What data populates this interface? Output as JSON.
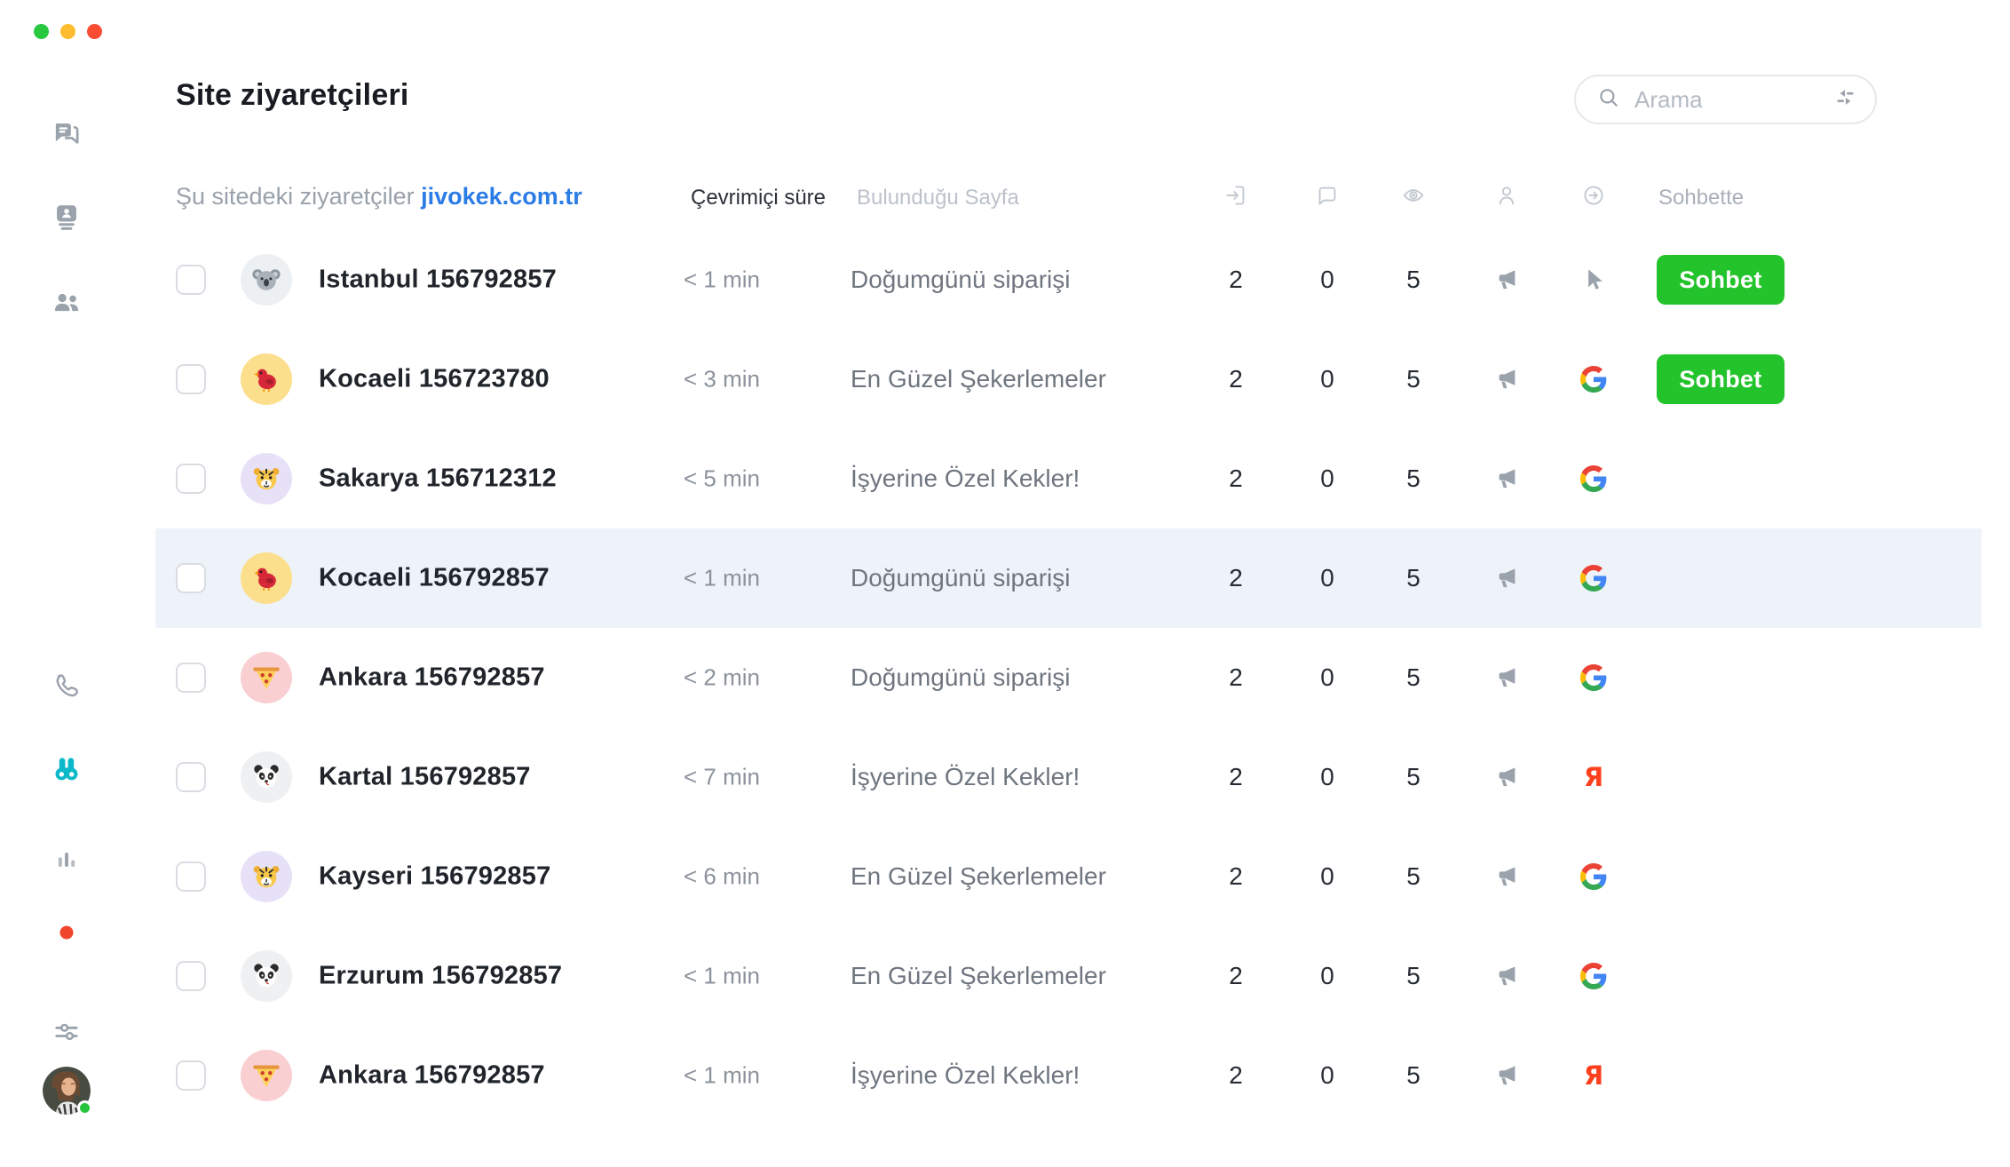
{
  "window": {
    "traffic_lights": [
      "green",
      "yellow",
      "red"
    ]
  },
  "sidebar": {
    "items": [
      {
        "icon": "chats-icon"
      },
      {
        "icon": "contact-card-icon"
      },
      {
        "icon": "people-icon"
      },
      {
        "icon": "phone-icon"
      },
      {
        "icon": "binoculars-icon",
        "active": true
      },
      {
        "icon": "bar-chart-icon"
      },
      {
        "icon": "notification-dot"
      },
      {
        "icon": "sliders-icon"
      },
      {
        "icon": "user-avatar",
        "status": "online"
      }
    ]
  },
  "page": {
    "title": "Site ziyaretçileri"
  },
  "search": {
    "placeholder": "Arama",
    "icons": [
      "search-icon",
      "filter-icon"
    ]
  },
  "table": {
    "subtitle": "Şu sitedeki ziyaretçiler",
    "site_link": "jivokek.com.tr",
    "columns": {
      "online_time": "Çevrimiçi süre",
      "current_page": "Bulunduğu Sayfa",
      "in_chat": "Sohbette",
      "icon_columns": [
        "login-icon",
        "chat-bubble-icon",
        "eye-icon",
        "visitor-icon",
        "redirect-icon"
      ]
    },
    "chat_button_label": "Sohbet",
    "rows": [
      {
        "name": "Istanbul 156792857",
        "online_time": "< 1 min",
        "page": "Doğumgünü siparişi",
        "visits": "2",
        "chats": "0",
        "views": "5",
        "avatar": "koala",
        "source": "cursor",
        "has_chat_button": true,
        "highlighted": false
      },
      {
        "name": "Kocaeli 156723780",
        "online_time": "< 3 min",
        "page": "En Güzel Şekerlemeler",
        "visits": "2",
        "chats": "0",
        "views": "5",
        "avatar": "bird",
        "source": "google",
        "has_chat_button": true,
        "highlighted": false
      },
      {
        "name": "Sakarya 156712312",
        "online_time": "< 5 min",
        "page": "İşyerine Özel Kekler!",
        "visits": "2",
        "chats": "0",
        "views": "5",
        "avatar": "tiger",
        "source": "google",
        "has_chat_button": false,
        "highlighted": false
      },
      {
        "name": "Kocaeli 156792857",
        "online_time": "< 1 min",
        "page": "Doğumgünü siparişi",
        "visits": "2",
        "chats": "0",
        "views": "5",
        "avatar": "bird",
        "source": "google",
        "has_chat_button": false,
        "highlighted": true
      },
      {
        "name": "Ankara 156792857",
        "online_time": "< 2 min",
        "page": "Doğumgünü siparişi",
        "visits": "2",
        "chats": "0",
        "views": "5",
        "avatar": "pizza",
        "source": "google",
        "has_chat_button": false,
        "highlighted": false
      },
      {
        "name": "Kartal 156792857",
        "online_time": "< 7 min",
        "page": "İşyerine Özel Kekler!",
        "visits": "2",
        "chats": "0",
        "views": "5",
        "avatar": "panda",
        "source": "yandex",
        "has_chat_button": false,
        "highlighted": false
      },
      {
        "name": "Kayseri 156792857",
        "online_time": "< 6 min",
        "page": "En Güzel Şekerlemeler",
        "visits": "2",
        "chats": "0",
        "views": "5",
        "avatar": "tiger",
        "source": "google",
        "has_chat_button": false,
        "highlighted": false
      },
      {
        "name": "Erzurum 156792857",
        "online_time": "< 1 min",
        "page": "En Güzel Şekerlemeler",
        "visits": "2",
        "chats": "0",
        "views": "5",
        "avatar": "panda",
        "source": "google",
        "has_chat_button": false,
        "highlighted": false
      },
      {
        "name": "Ankara 156792857",
        "online_time": "< 1 min",
        "page": "İşyerine Özel Kekler!",
        "visits": "2",
        "chats": "0",
        "views": "5",
        "avatar": "pizza",
        "source": "yandex",
        "has_chat_button": false,
        "highlighted": false
      }
    ]
  },
  "colors": {
    "accent_green": "#23c32b",
    "link_blue": "#2b7ce5",
    "active_teal": "#0cb9c9",
    "highlight_row": "#eef3f9",
    "yandex_red": "#fc3f1d",
    "notification_red": "#f1462c"
  },
  "avatar_backgrounds": {
    "koala": "#edf0f3",
    "bird": "#fbdf8d",
    "tiger": "#e7e1f8",
    "pizza": "#f9cfd2",
    "panda": "#eef0f2"
  }
}
